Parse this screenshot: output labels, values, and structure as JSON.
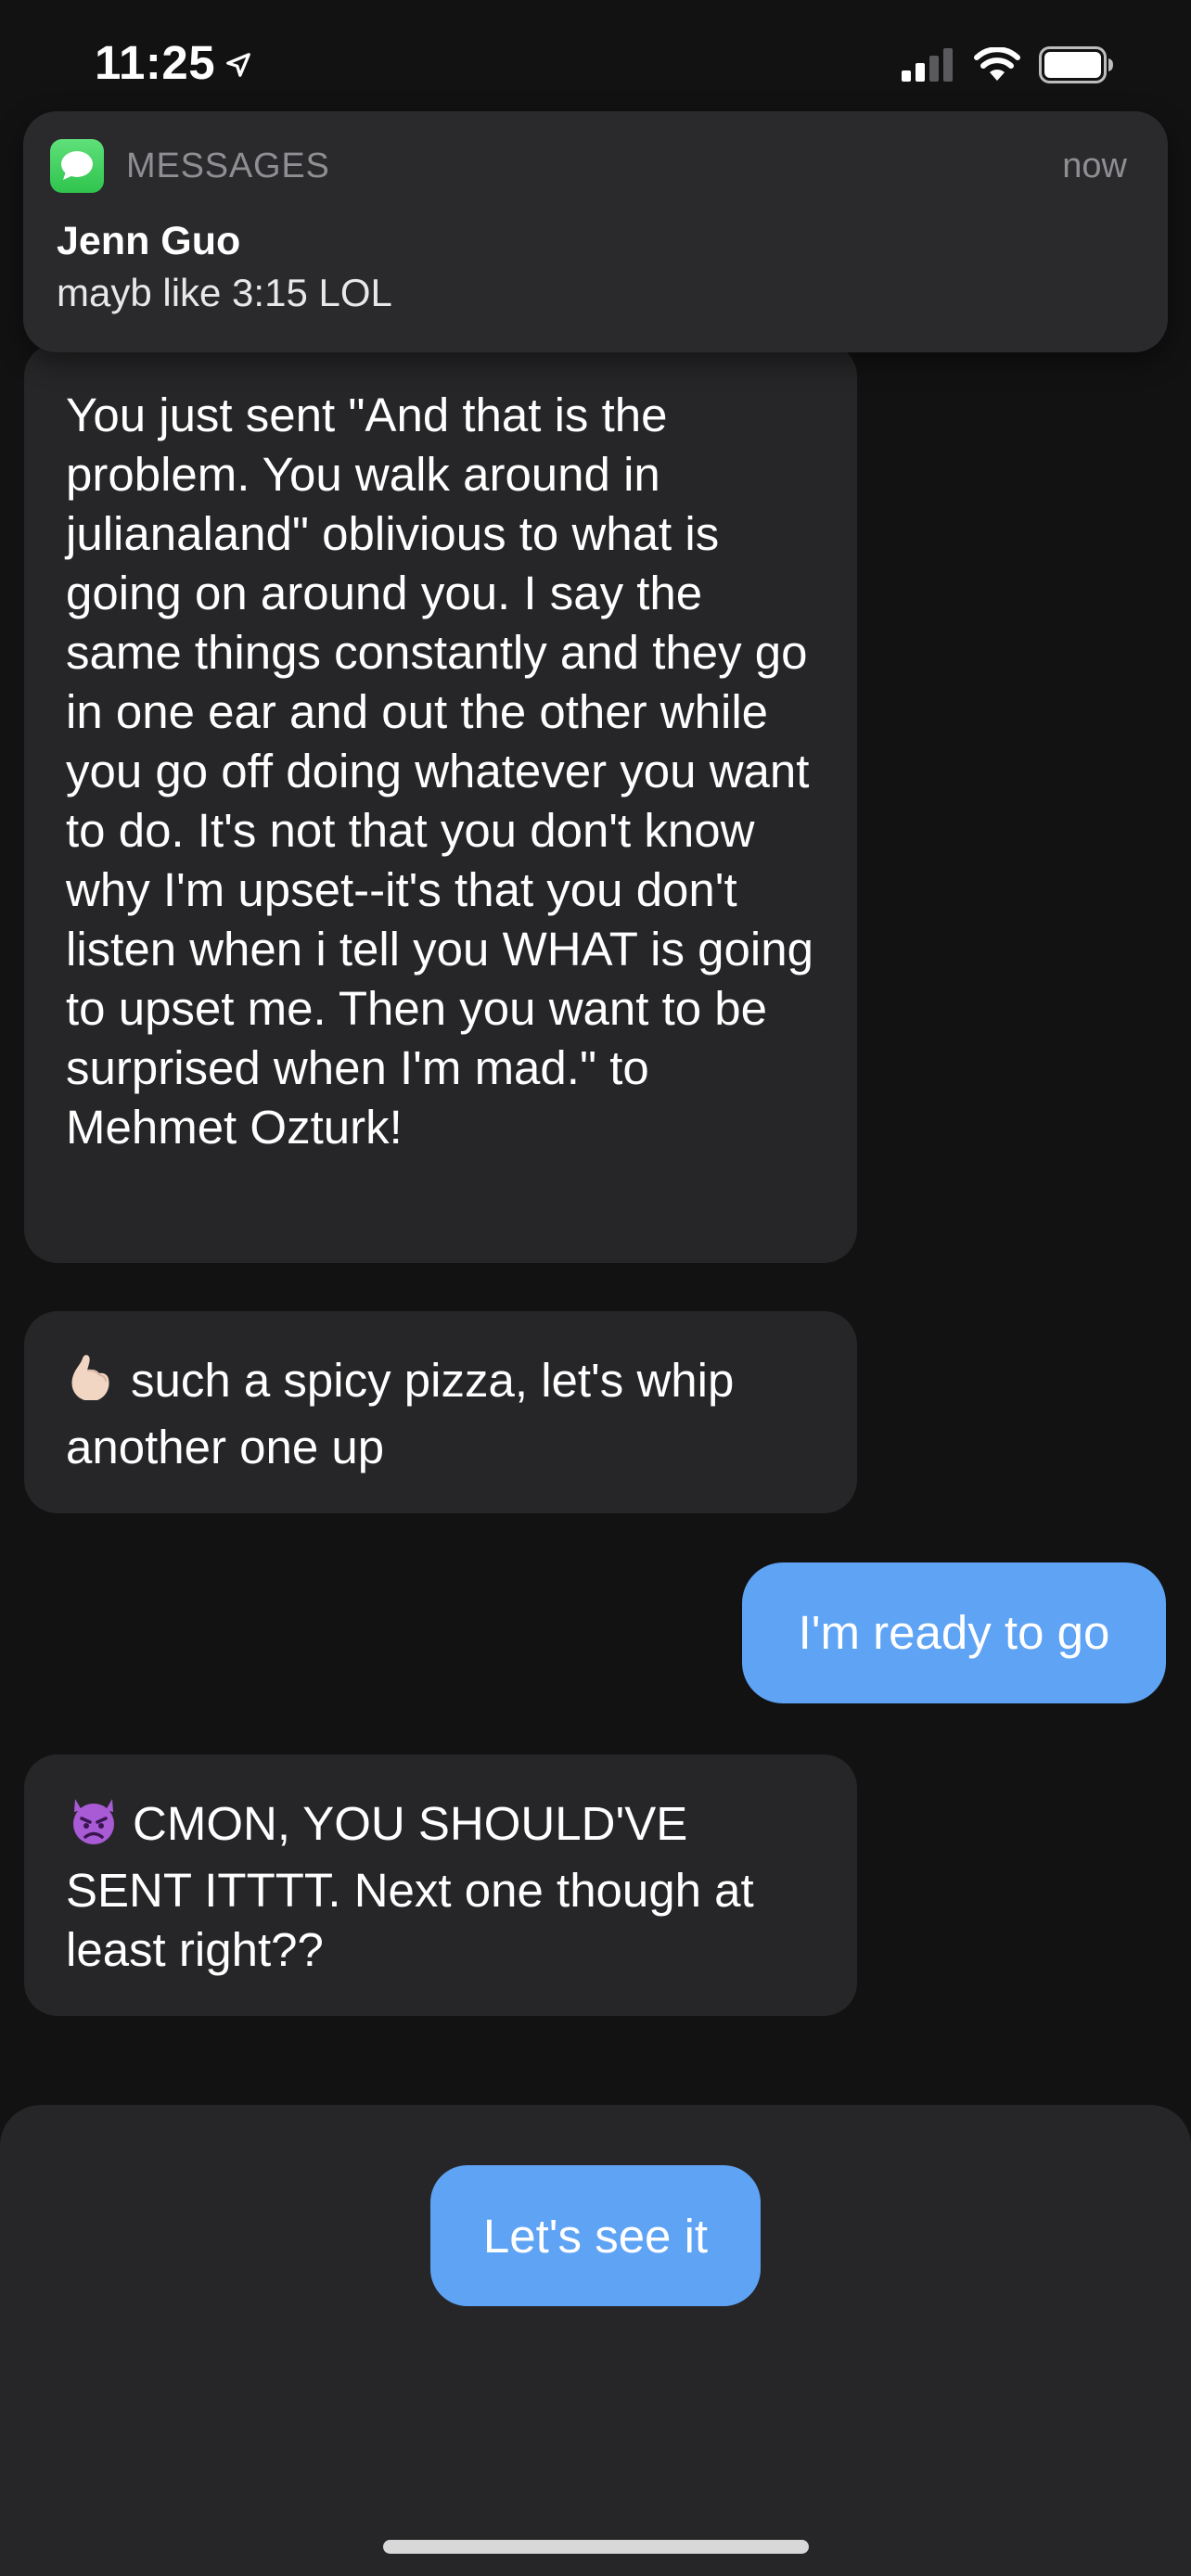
{
  "status_bar": {
    "time": "11:25",
    "icons": [
      "location-arrow-icon",
      "cellular-signal-icon",
      "wifi-icon",
      "battery-icon"
    ]
  },
  "notification": {
    "app_icon": "messages-icon",
    "app_name": "MESSAGES",
    "time": "now",
    "sender": "Jenn Guo",
    "body": "mayb like 3:15 LOL"
  },
  "messages": [
    {
      "direction": "incoming",
      "text": "You just sent \"And that is the problem. You walk around in julianaland\" oblivious to what is going on around you. I say the same things constantly and they go in one ear and out the other while you go off doing whatever you want to do. It's not that you don't know why I'm upset--it's that you don't listen when i tell you WHAT is going to upset me. Then you want to be surprised when I'm mad.\" to Mehmet Ozturk!"
    },
    {
      "direction": "incoming",
      "emoji": "pinched-fingers-emoji",
      "text": "such a spicy pizza, let's whip another one up"
    },
    {
      "direction": "outgoing",
      "text": "I'm ready to go"
    },
    {
      "direction": "incoming",
      "emoji": "angry-devil-emoji",
      "text": "CMON, YOU SHOULD'VE SENT ITTTT. Next one though at least right??"
    }
  ],
  "reply_button": {
    "label": "Let's see it"
  },
  "colors": {
    "background": "#121212",
    "incoming_bubble": "#262628",
    "outgoing_bubble": "#5fa3f5",
    "notification_bg": "#2a2a2c",
    "secondary_text": "#8e8e93",
    "messages_green": "#34c759"
  }
}
